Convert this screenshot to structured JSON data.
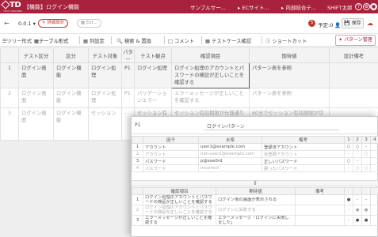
{
  "header": {
    "logo_text": "TD",
    "logo_sub": "TEST DESIGNER",
    "title": "【機能】ログイン機能",
    "breadcrumbs": [
      "サンプルサー...",
      "ECサイト...",
      "内部結合テ...",
      "SHIFT太郎"
    ],
    "icons": [
      "help-icon",
      "settings-icon",
      "user-icon"
    ]
  },
  "toolbar": {
    "version": "0.0.1",
    "status_pill": "詳細設計",
    "doc_pill": "Ext...",
    "notification_count": "5",
    "yotei_label": "予定:0",
    "save_label": "保存"
  },
  "toolbar2": {
    "tree_label": "ツリー形式",
    "table_label": "テーブル形式",
    "column_label": "列設定",
    "search_label": "検索 & 置換",
    "comment_label": "コメント",
    "testcase_label": "テストケース確認",
    "shortcut_label": "ショートカット",
    "pattern_label": "パターン管理"
  },
  "grid": {
    "columns": [
      "",
      "テスト区分",
      "区分",
      "テスト対象",
      "パター",
      "テスト観点",
      "確認項目",
      "期待値",
      "設計備考"
    ],
    "rows": [
      [
        "1",
        "ログイン画面",
        "ログイン機能",
        "ログイン処理",
        "P1",
        "ログイン処理",
        "ログイン処理のアカウントとパスワードの検証が正しいことを確認する",
        "パターン表を参照",
        ""
      ],
      [
        "2",
        "ログイン画面",
        "ログイン機能",
        "ログイン処理",
        "P1",
        "バリデーションエラー",
        "エラーメッセージが正しいことを確認する",
        "パターン表を参照",
        ""
      ],
      [
        "3",
        "ログイン画面",
        "ログイン機能",
        "セッション",
        "-",
        "セッション有効期限",
        "セッション有効期限が仕様通りであることを確認する",
        "60分でセッション有効期限が切れる。セッションが切れた状態でアクセスするとログイン画面が表示される",
        ""
      ]
    ]
  },
  "popup": {
    "pattern_id": "P1",
    "pattern_name": "ログインパターン",
    "factor_headers": [
      "",
      "因子",
      "水準",
      "備考",
      "1",
      "2",
      "3",
      "4"
    ],
    "factors": [
      [
        "1",
        "アカウント",
        "user1@example.com",
        "登録済アカウント",
        "○",
        "○",
        "-",
        ""
      ],
      [
        "2",
        "アカウント",
        "non-user1@example.com",
        "未登録アカウント",
        "-",
        "-",
        "○",
        ""
      ],
      [
        "3",
        "パスワード",
        "p@ssw0rd",
        "正しいパスワード",
        "○",
        "-",
        "",
        ""
      ],
      [
        "4",
        "パスワード",
        "incorrect",
        "誤ったパスワード",
        "-",
        "○",
        "○",
        ""
      ]
    ],
    "check_headers": [
      "",
      "確認項目",
      "期待値",
      "備考",
      "",
      "",
      "",
      ""
    ],
    "checks": [
      [
        "1",
        "ログイン処理のアカウントとパスワードの検証が正しいことを確認する",
        "ログイン後の画面が表示される",
        "",
        "●",
        "-",
        "-",
        ""
      ],
      [
        "2",
        "ログイン処理のアカウントとパスワードの検証が正しいことを確認する",
        "ログインに失敗する",
        "",
        "-",
        "●",
        "●",
        ""
      ],
      [
        "3",
        "エラーメッセージが正しいことを確認する",
        "エラーメッセージ「ログインに失敗しました」",
        "",
        "-",
        "●",
        "●",
        ""
      ]
    ]
  }
}
